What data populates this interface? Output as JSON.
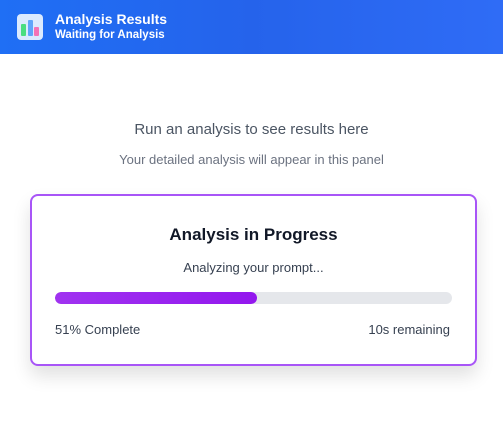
{
  "header": {
    "title": "Analysis Results",
    "subtitle": "Waiting for Analysis",
    "icon": "bar-chart-icon"
  },
  "empty_state": {
    "message": "Run an analysis to see results here",
    "detail": "Your detailed analysis will appear in this panel"
  },
  "progress_card": {
    "title": "Analysis in Progress",
    "status": "Analyzing your prompt...",
    "progress_fraction": 0.51,
    "percent_label": "51% Complete",
    "remaining_label": "10s remaining"
  },
  "colors": {
    "header_bg": "#2563eb",
    "card_border": "#a855f7",
    "progress_fill": "#9317ee",
    "progress_track": "#e5e7eb"
  }
}
